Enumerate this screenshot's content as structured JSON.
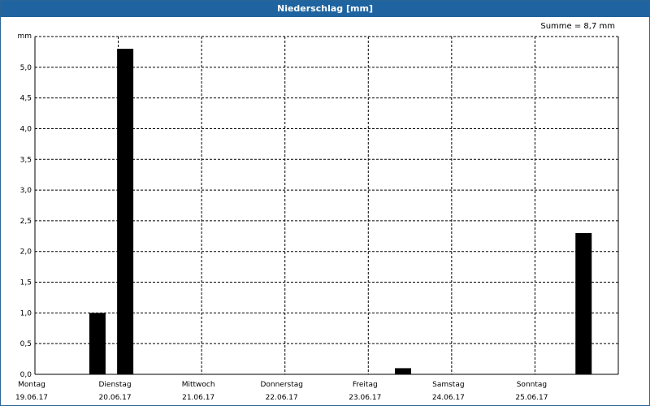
{
  "window": {
    "title": "Niederschlag [mm]",
    "sum_label": "Summe = 8,7 mm"
  },
  "chart_data": {
    "type": "bar",
    "title": "Niederschlag [mm]",
    "ylabel": "mm",
    "ylim": [
      0,
      5.5
    ],
    "yticks": [
      0,
      0.5,
      1.0,
      1.5,
      2.0,
      2.5,
      3.0,
      3.5,
      4.0,
      4.5,
      5.0
    ],
    "ytick_labels": [
      "0,0",
      "0,5",
      "1,0",
      "1,5",
      "2,0",
      "2,5",
      "3,0",
      "3,5",
      "4,0",
      "4,5",
      "5,0"
    ],
    "days": [
      {
        "weekday": "Montag",
        "date": "19.06.17"
      },
      {
        "weekday": "Dienstag",
        "date": "20.06.17"
      },
      {
        "weekday": "Mittwoch",
        "date": "21.06.17"
      },
      {
        "weekday": "Donnerstag",
        "date": "22.06.17"
      },
      {
        "weekday": "Freitag",
        "date": "23.06.17"
      },
      {
        "weekday": "Samstag",
        "date": "24.06.17"
      },
      {
        "weekday": "Sonntag",
        "date": "25.06.17"
      }
    ],
    "bars": [
      {
        "day": "Montag 19.06.17",
        "time": "18:00",
        "value": 1.0
      },
      {
        "day": "Dienstag 20.06.17",
        "time": "02:00",
        "value": 5.3
      },
      {
        "day": "Freitag 23.06.17",
        "time": "10:00",
        "value": 0.1
      },
      {
        "day": "Sonntag 25.06.17",
        "time": "14:00",
        "value": 2.3
      }
    ],
    "grid": true,
    "bar_color": "#000000"
  }
}
